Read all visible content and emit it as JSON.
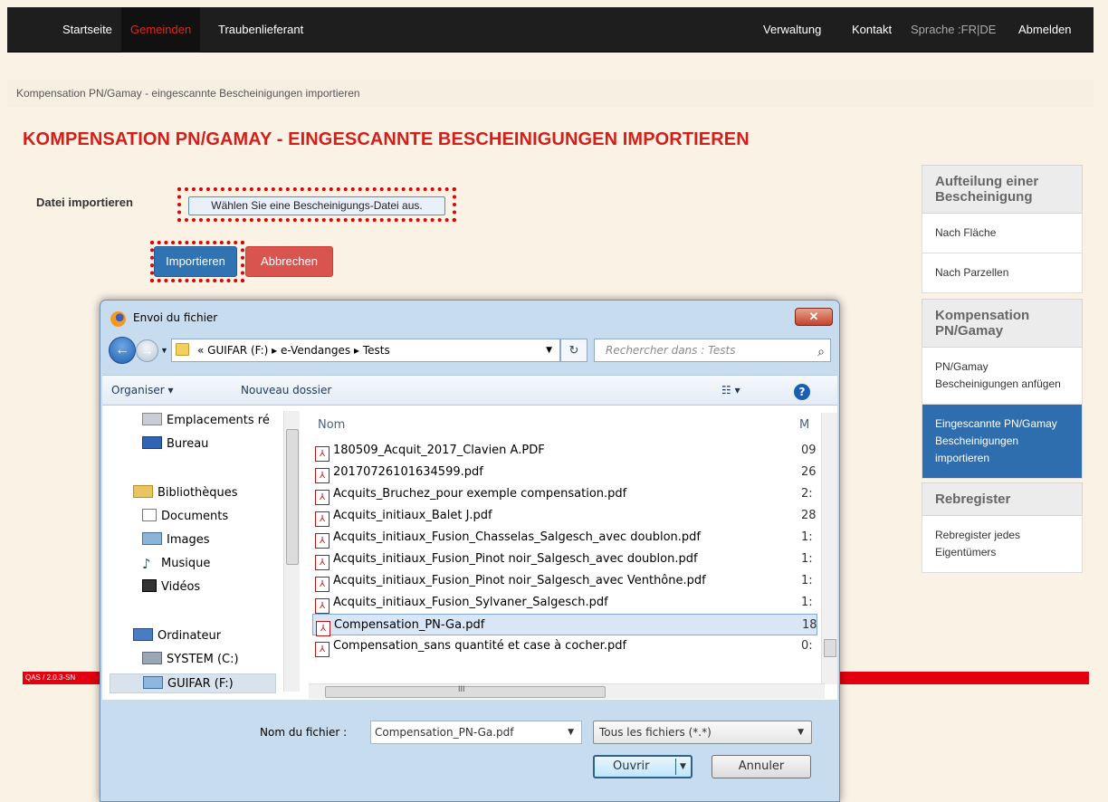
{
  "nav": {
    "left": [
      "Startseite",
      "Gemeinden",
      "Traubenlieferant"
    ],
    "right": [
      "Verwaltung",
      "Kontakt",
      "Abmelden"
    ],
    "language": "Sprache :FR|DE"
  },
  "breadcrumb": "Kompensation PN/Gamay - eingescannte Bescheinigungen importieren",
  "page_title": "KOMPENSATION PN/GAMAY - EINGESCANNTE BESCHEINIGUNGEN IMPORTIEREN",
  "form": {
    "file_label": "Datei importieren",
    "file_button": "Wählen Sie eine Bescheinigungs-Datei aus.",
    "import_button": "Importieren",
    "cancel_button": "Abbrechen"
  },
  "footer_version": "QAS / 2.0.3-SN",
  "sidebar": {
    "sections": [
      {
        "title": "Aufteilung einer Bescheinigung",
        "items": [
          "Nach Fläche",
          "Nach Parzellen"
        ]
      },
      {
        "title": "Kompensation PN/Gamay",
        "items": [
          "PN/Gamay Bescheinigungen anfügen",
          "Eingescannte PN/Gamay Bescheinigungen importieren"
        ]
      },
      {
        "title": "Rebregister",
        "items": [
          "Rebregister jedes Eigentümers"
        ]
      }
    ]
  },
  "dialog": {
    "title": "Envoi du fichier",
    "address": [
      "«",
      "GUIFAR (F:)",
      "▸",
      "e-Vendanges",
      "▸",
      "Tests"
    ],
    "search_placeholder": "Rechercher dans : Tests",
    "toolbar": {
      "organize": "Organiser ▾",
      "new_folder": "Nouveau dossier"
    },
    "tree": [
      {
        "label": "Emplacements ré",
        "icon": "places-icon"
      },
      {
        "label": "Bureau",
        "icon": "desktop-icon"
      },
      {
        "label": "Bibliothèques",
        "icon": "library-icon"
      },
      {
        "label": "Documents",
        "icon": "document-icon"
      },
      {
        "label": "Images",
        "icon": "images-icon"
      },
      {
        "label": "Musique",
        "icon": "music-icon"
      },
      {
        "label": "Vidéos",
        "icon": "video-icon"
      },
      {
        "label": "Ordinateur",
        "icon": "computer-icon"
      },
      {
        "label": "SYSTEM (C:)",
        "icon": "drive-icon"
      },
      {
        "label": "GUIFAR (F:)",
        "icon": "network-drive-icon"
      }
    ],
    "columns": {
      "name": "Nom",
      "modified": "M"
    },
    "files": [
      {
        "name": "180509_Acquit_2017_Clavien A.PDF",
        "m": "09"
      },
      {
        "name": "20170726101634599.pdf",
        "m": "26"
      },
      {
        "name": "Acquits_Bruchez_pour exemple compensation.pdf",
        "m": "2:"
      },
      {
        "name": "Acquits_initiaux_Balet J.pdf",
        "m": "28"
      },
      {
        "name": "Acquits_initiaux_Fusion_Chasselas_Salgesch_avec doublon.pdf",
        "m": "1:"
      },
      {
        "name": "Acquits_initiaux_Fusion_Pinot noir_Salgesch_avec doublon.pdf",
        "m": "1:"
      },
      {
        "name": "Acquits_initiaux_Fusion_Pinot noir_Salgesch_avec Venthône.pdf",
        "m": "1:"
      },
      {
        "name": "Acquits_initiaux_Fusion_Sylvaner_Salgesch.pdf",
        "m": "1:"
      },
      {
        "name": "Compensation_PN-Ga.pdf",
        "m": "18"
      },
      {
        "name": "Compensation_sans quantité et case à cocher.pdf",
        "m": "0:"
      }
    ],
    "filename_label": "Nom du fichier :",
    "filename_value": "Compensation_PN-Ga.pdf",
    "filetype_value": "Tous les fichiers (*.*)",
    "open_button": "Ouvrir",
    "cancel_button": "Annuler",
    "hscroll_mark": "III"
  }
}
